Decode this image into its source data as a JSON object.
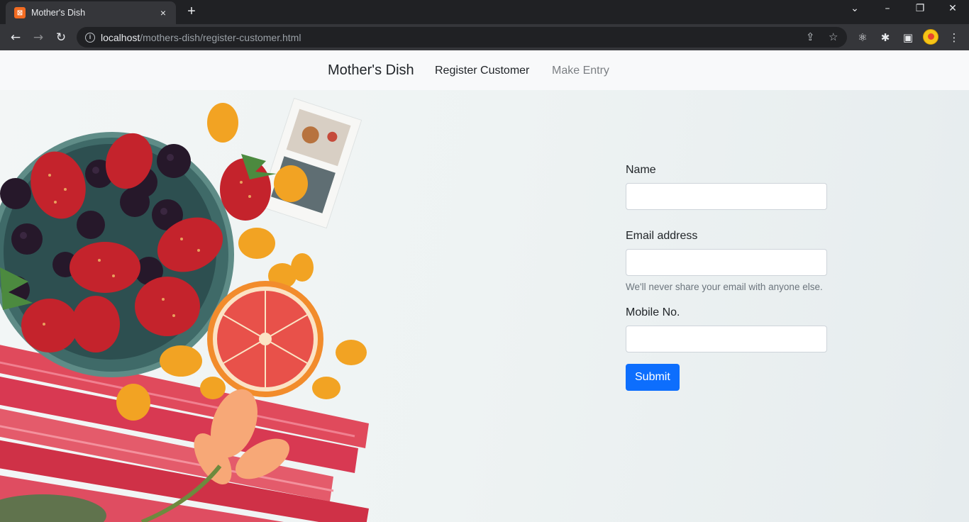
{
  "browser": {
    "tab_title": "Mother's Dish",
    "favicon_label": "⊠",
    "tab_close": "×",
    "new_tab": "+",
    "window_controls": {
      "tab_search": "⌄",
      "minimize": "–",
      "restore": "❐",
      "close": "✕"
    },
    "nav": {
      "back": "←",
      "forward": "→",
      "reload": "↻"
    },
    "url_host": "localhost",
    "url_path": "/mothers-dish/register-customer.html",
    "omnibox_icons": {
      "share": "⇪",
      "bookmark": "☆"
    },
    "toolbar_icons": {
      "extension_react": "⚛",
      "extensions": "✱",
      "sidepanel": "▣",
      "menu": "⋮"
    }
  },
  "navbar": {
    "brand": "Mother's Dish",
    "links": [
      {
        "label": "Register Customer",
        "active": true
      },
      {
        "label": "Make Entry",
        "active": false
      }
    ]
  },
  "form": {
    "name_label": "Name",
    "name_value": "",
    "email_label": "Email address",
    "email_value": "",
    "email_help": "We'll never share your email with anyone else.",
    "mobile_label": "Mobile No.",
    "mobile_value": "",
    "submit_label": "Submit"
  },
  "colors": {
    "primary": "#0d6efd",
    "navbar_bg": "#f8f9fa",
    "chrome_dark": "#202124",
    "chrome_toolbar": "#35363a"
  }
}
